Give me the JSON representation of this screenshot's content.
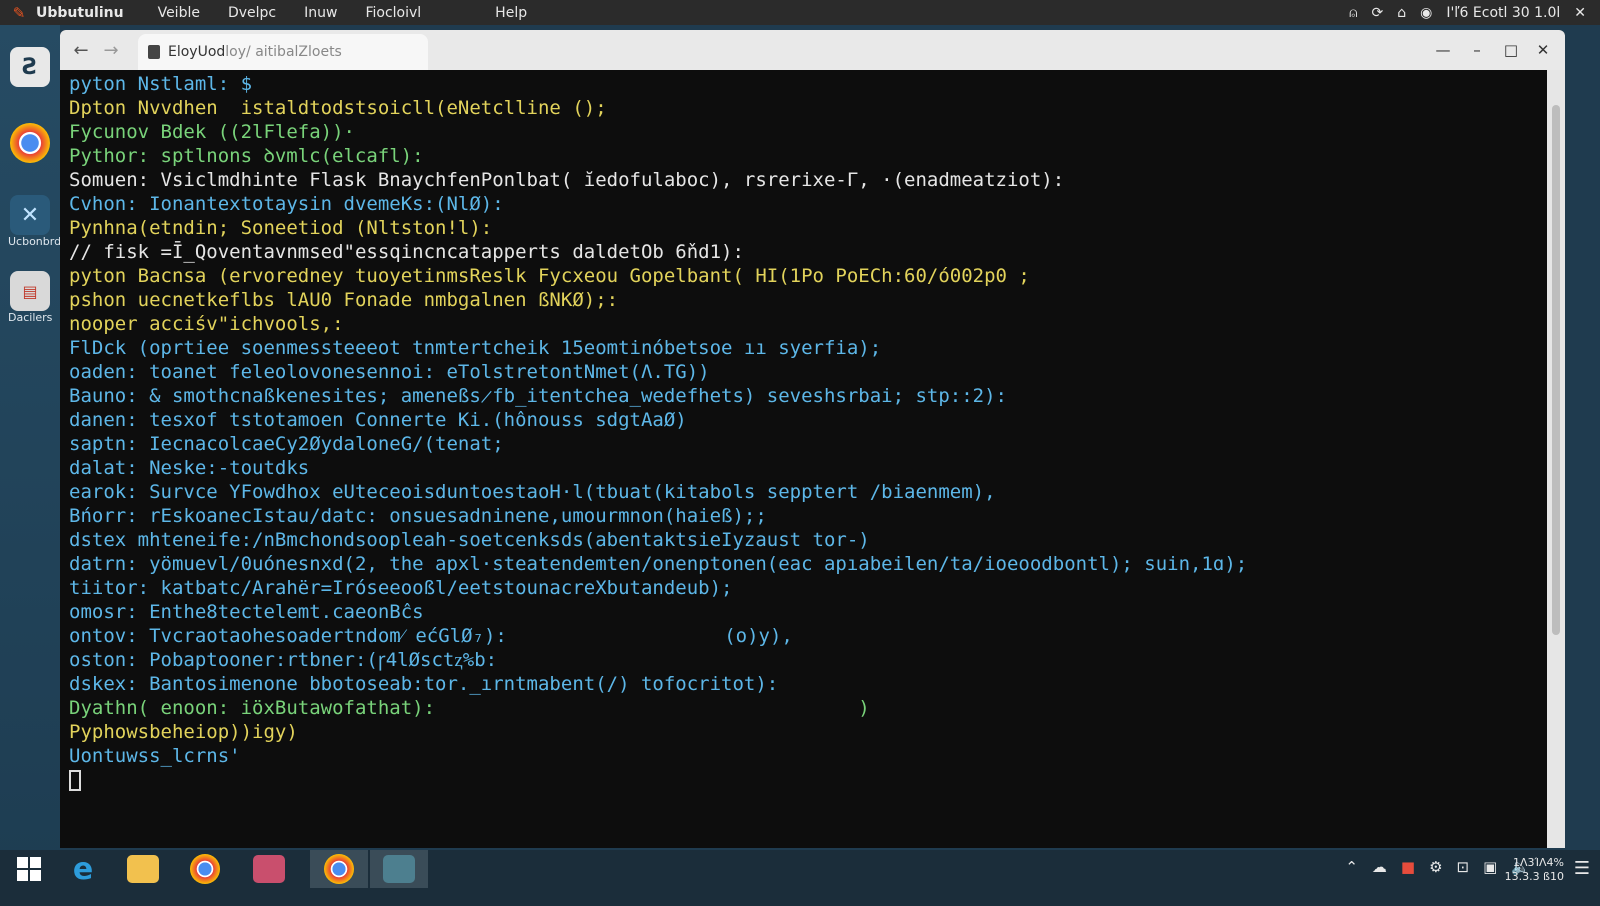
{
  "menubar": {
    "app": "Ubbutulinu",
    "items": [
      "Veible",
      "Dvelpc",
      "Inuw",
      "Fiocloivl",
      "Help"
    ],
    "clock": "I'ľ6 Ecotl 30  1.0l",
    "tray_icons": [
      "alert-icon",
      "sync-icon",
      "home-icon",
      "globe-icon",
      "close-icon"
    ]
  },
  "dock": {
    "items": [
      {
        "icon": "terminal-icon",
        "label": ""
      },
      {
        "icon": "chrome-icon",
        "label": ""
      },
      {
        "icon": "vscode-icon",
        "label": "Ucbonbrd"
      },
      {
        "icon": "folder-icon",
        "label": "Dacilers"
      }
    ]
  },
  "browser": {
    "tab_title": "EloyUod",
    "tab_path": " loy/ aitibalZloets",
    "back": "←",
    "forward": "→"
  },
  "terminal": {
    "lines": [
      {
        "text": "pyton Nstlaml: $ ",
        "color": "#5db7e8"
      },
      {
        "text": "Dpton Nvvdhen  istaldtodstsoicll(eNetclline ();",
        "color": "#e2d35b"
      },
      {
        "text": "Fycunov Bdek ((2lFlefa))·",
        "color": "#79d37a"
      },
      {
        "text": "Pythor: sptlnons ꝺvmlc(elcafl):",
        "color": "#79d37a"
      },
      {
        "text": "Somuen: Vsiclmdhinte Flask BnaychfenPonlbat( ĭedofulaboc), rsrerixe-Γ, ·(enadmeatziot):",
        "color": "#e6e6e6"
      },
      {
        "text": "Cvhon: Ionantextotaysin dvemeKs:(NlØ):",
        "color": "#5db7e8"
      },
      {
        "text": "Pynhna(etndin; Soneetiod (Nltston!l):",
        "color": "#e2d35b"
      },
      {
        "text": "// fisk =Ī_Qoventavnmsed\"essqincncatapperts daldetOb 6ňd1):",
        "color": "#e6e6e6"
      },
      {
        "text": "pyton Bacnsa (ervoredney tuoyetinmsReslk Fycxeou Gopelbant( HI(1Po PoECh:60/ó002p0 ;",
        "color": "#e2d35b"
      },
      {
        "text": "pshon uecnetkeflbs lAU0 Fonade nmbgalnen ßNKØ);:",
        "color": "#e2d35b"
      },
      {
        "text": "nooper acciśv\"ichvools,:",
        "color": "#e2d35b"
      },
      {
        "text": "FlDck (oprtiee soenmessteeeot tnmtertcheik 15eomtinóbetsoe ıı syerfia);",
        "color": "#5db7e8"
      },
      {
        "text": "oaden: toanet feleolovonesennoi: eTolstretontNmet(Λ.TG))",
        "color": "#5db7e8"
      },
      {
        "text": "Bauno: & smothcnaßkenesites; ameneßs̷fb_itentchea_wedefhets) seveshsrbai; stp::2):",
        "color": "#5db7e8"
      },
      {
        "text": "danen: tesxof tstotamoen Connerte Ki.(hônouss sdgtAaØ)",
        "color": "#5db7e8"
      },
      {
        "text": "saptn: IecnacolcaeCy2ØydaloneG/(tenat;",
        "color": "#5db7e8"
      },
      {
        "text": "dalat: Neske:-toutdks",
        "color": "#5db7e8"
      },
      {
        "text": "earok: Survce YFowdhox eUteceoisduntoestaoH·l(tbuat(kitabols sepptert /biaenmem),",
        "color": "#5db7e8"
      },
      {
        "text": "Bńorr: rEskoanecIstau/datc: onsuesadninene,umourmnon(haieß);;",
        "color": "#5db7e8"
      },
      {
        "text": "dstex mhteneife:/nBmchondsoopleah-soetcenksds(abentaktsieIyzaust tor-)",
        "color": "#5db7e8"
      },
      {
        "text": "datrn: yömuevl/0uónesnxd(2, the apxl·steatendemten/onenptonen(eac apıabeilen/ta/ioeoodbontl); suin,1ɑ);",
        "color": "#5db7e8"
      },
      {
        "text": "tiitor: katbatc/Arahër=Iróseeooßl/eetstounacreXbutandeub);",
        "color": "#5db7e8"
      },
      {
        "text": "omosr: Enthe8tectelemt.caeonBĉs",
        "color": "#5db7e8"
      },
      {
        "text": "ontov: Tvcraotaohesoadertndom⁄ ećGlØ₇):                   (o)y),",
        "color": "#5db7e8"
      },
      {
        "text": "oston: Pobaptooner:rtbner:(ꞅ4lØsctⱬ%b:",
        "color": "#5db7e8"
      },
      {
        "text": "dskex: Bantosimenone bbotoseab:tor._ırntmabent(/) tofocritot):  ",
        "color": "#5db7e8"
      },
      {
        "text": "Dyathn( enoon: iöxButawofathat):                                     )",
        "color": "#79d37a"
      },
      {
        "text": "Pyphowsbeheiop))igy)",
        "color": "#e2d35b"
      },
      {
        "text": "Uontuwss_lcrns' ",
        "color": "#5db7e8"
      }
    ]
  },
  "taskbar": {
    "apps": [
      "windows-start-icon",
      "edge-icon",
      "file-explorer-icon",
      "chrome-icon",
      "files-icon",
      "chrome-icon",
      "browser-icon"
    ],
    "clock_time": "1Ʌ3ΊΛ4%",
    "clock_date": "13.3.3 ß10"
  }
}
